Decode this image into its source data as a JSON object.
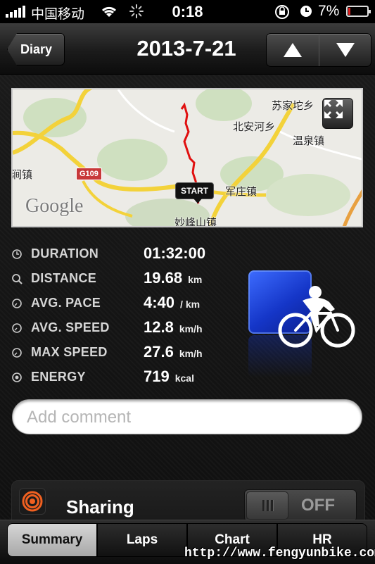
{
  "status_bar": {
    "carrier": "中国移动",
    "time": "0:18",
    "battery": "7%"
  },
  "nav": {
    "back_label": "Diary",
    "title": "2013-7-21"
  },
  "map": {
    "labels": {
      "l1": "苏家坨乡",
      "l2": "北安河乡",
      "l3": "温泉镇",
      "l4": "军庄镇",
      "l5": "妙峰山镇",
      "l6": "涧镇"
    },
    "road": "G109",
    "brand": "Google",
    "start_marker": "START"
  },
  "stats": [
    {
      "label": "DURATION",
      "value": "01:32:00",
      "unit": ""
    },
    {
      "label": "DISTANCE",
      "value": "19.68",
      "unit": "km"
    },
    {
      "label": "AVG. PACE",
      "value": "4:40",
      "unit": "/ km"
    },
    {
      "label": "AVG. SPEED",
      "value": "12.8",
      "unit": "km/h"
    },
    {
      "label": "MAX SPEED",
      "value": "27.6",
      "unit": "km/h"
    },
    {
      "label": "ENERGY",
      "value": "719",
      "unit": "kcal"
    }
  ],
  "activity_icon": "cycling-icon",
  "comment": {
    "placeholder": "Add comment",
    "value": ""
  },
  "sharing": {
    "label": "Sharing",
    "toggle": "OFF"
  },
  "tabs": [
    {
      "label": "Summary",
      "active": true
    },
    {
      "label": "Laps",
      "active": false
    },
    {
      "label": "Chart",
      "active": false
    },
    {
      "label": "HR",
      "active": false
    }
  ],
  "watermark": "http://www.fengyunbike.com",
  "colors": {
    "route": "#e01010",
    "activity_blue": "#1536c8",
    "road_yellow": "#f3d23a"
  }
}
